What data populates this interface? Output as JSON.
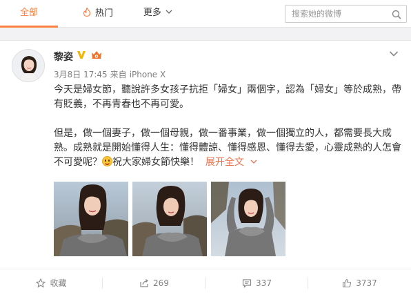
{
  "tabs": {
    "all": "全部",
    "hot": "热门",
    "more": "更多"
  },
  "search": {
    "placeholder": "搜索她的微博"
  },
  "post": {
    "author": "黎姿",
    "time": "3月8日 17:45",
    "source_prefix": "来自",
    "source": "iPhone X",
    "paragraph1": "今天是婦女節，聽說許多女孩子抗拒「婦女」兩個字，認為「婦女」等於成熟，帶有貶義，不再青春也不再可愛。",
    "paragraph2_a": "但是，做一個妻子，做一個母親，做一番事業，做一個獨立的人，都需要長大成熟。成熟就是開始懂得人生：懂得體諒、懂得感恩、懂得去愛，心靈成熟的人怎會不可愛呢？",
    "paragraph2_b": "祝大家婦女節快樂！",
    "expand_label": "展开全文",
    "photos": [
      "photo-1",
      "photo-2",
      "photo-3"
    ]
  },
  "actions": {
    "favorite": "收藏",
    "repost": "269",
    "comment": "337",
    "like": "3737"
  },
  "colors": {
    "accent": "#ff8140",
    "link": "#eb7350",
    "muted": "#808080"
  },
  "icons": {
    "hot": "fire-icon",
    "search": "search-icon",
    "verified": "verified-badge-icon",
    "vip": "vip-badge-icon",
    "collapse": "chevron-down-icon",
    "favorite": "star-icon",
    "repost": "repost-icon",
    "comment": "comment-icon",
    "like": "thumbs-up-icon"
  }
}
